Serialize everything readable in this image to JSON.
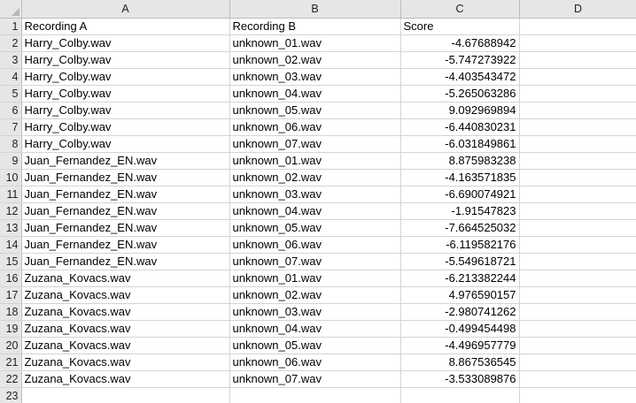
{
  "columns": [
    "A",
    "B",
    "C",
    "D"
  ],
  "headers": {
    "a": "Recording A",
    "b": "Recording B",
    "c": "Score",
    "d": ""
  },
  "header_row_number": "1",
  "rows": [
    {
      "n": "2",
      "a": "Harry_Colby.wav",
      "b": "unknown_01.wav",
      "c": "-4.67688942"
    },
    {
      "n": "3",
      "a": "Harry_Colby.wav",
      "b": "unknown_02.wav",
      "c": "-5.747273922"
    },
    {
      "n": "4",
      "a": "Harry_Colby.wav",
      "b": "unknown_03.wav",
      "c": "-4.403543472"
    },
    {
      "n": "5",
      "a": "Harry_Colby.wav",
      "b": "unknown_04.wav",
      "c": "-5.265063286"
    },
    {
      "n": "6",
      "a": "Harry_Colby.wav",
      "b": "unknown_05.wav",
      "c": "9.092969894"
    },
    {
      "n": "7",
      "a": "Harry_Colby.wav",
      "b": "unknown_06.wav",
      "c": "-6.440830231"
    },
    {
      "n": "8",
      "a": "Harry_Colby.wav",
      "b": "unknown_07.wav",
      "c": "-6.031849861"
    },
    {
      "n": "9",
      "a": "Juan_Fernandez_EN.wav",
      "b": "unknown_01.wav",
      "c": "8.875983238"
    },
    {
      "n": "10",
      "a": "Juan_Fernandez_EN.wav",
      "b": "unknown_02.wav",
      "c": "-4.163571835"
    },
    {
      "n": "11",
      "a": "Juan_Fernandez_EN.wav",
      "b": "unknown_03.wav",
      "c": "-6.690074921"
    },
    {
      "n": "12",
      "a": "Juan_Fernandez_EN.wav",
      "b": "unknown_04.wav",
      "c": "-1.91547823"
    },
    {
      "n": "13",
      "a": "Juan_Fernandez_EN.wav",
      "b": "unknown_05.wav",
      "c": "-7.664525032"
    },
    {
      "n": "14",
      "a": "Juan_Fernandez_EN.wav",
      "b": "unknown_06.wav",
      "c": "-6.119582176"
    },
    {
      "n": "15",
      "a": "Juan_Fernandez_EN.wav",
      "b": "unknown_07.wav",
      "c": "-5.549618721"
    },
    {
      "n": "16",
      "a": "Zuzana_Kovacs.wav",
      "b": "unknown_01.wav",
      "c": "-6.213382244"
    },
    {
      "n": "17",
      "a": "Zuzana_Kovacs.wav",
      "b": "unknown_02.wav",
      "c": "4.976590157"
    },
    {
      "n": "18",
      "a": "Zuzana_Kovacs.wav",
      "b": "unknown_03.wav",
      "c": "-2.980741262"
    },
    {
      "n": "19",
      "a": "Zuzana_Kovacs.wav",
      "b": "unknown_04.wav",
      "c": "-0.499454498"
    },
    {
      "n": "20",
      "a": "Zuzana_Kovacs.wav",
      "b": "unknown_05.wav",
      "c": "-4.496957779"
    },
    {
      "n": "21",
      "a": "Zuzana_Kovacs.wav",
      "b": "unknown_06.wav",
      "c": "8.867536545"
    },
    {
      "n": "22",
      "a": "Zuzana_Kovacs.wav",
      "b": "unknown_07.wav",
      "c": "-3.533089876"
    },
    {
      "n": "23",
      "a": "",
      "b": "",
      "c": ""
    }
  ]
}
